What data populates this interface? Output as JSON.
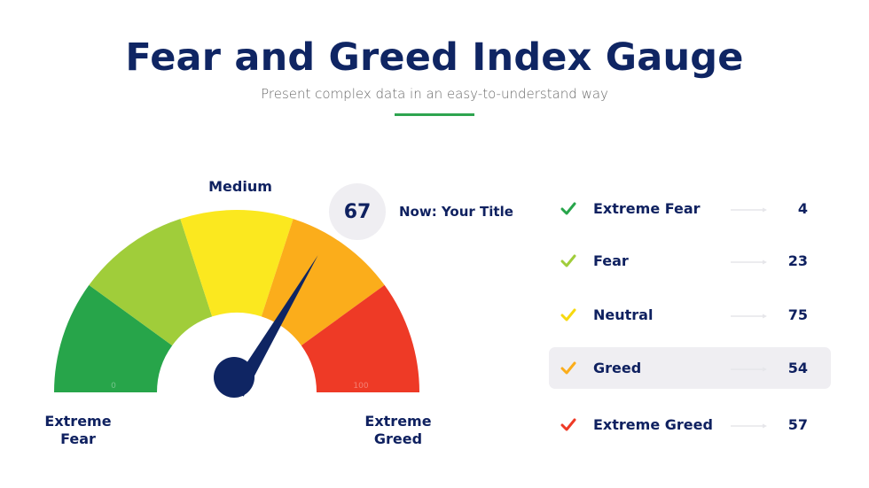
{
  "header": {
    "title": "Fear and Greed Index Gauge",
    "subtitle": "Present complex data in an easy-to-understand way",
    "accent_color": "#2ea44f"
  },
  "gauge": {
    "segments": [
      {
        "name": "Extreme Fear",
        "color": "#27a54a"
      },
      {
        "name": "Fear",
        "color": "#a0cd3a"
      },
      {
        "name": "Neutral",
        "color": "#fbe81f"
      },
      {
        "name": "Greed",
        "color": "#fbad1b"
      },
      {
        "name": "Extreme Greed",
        "color": "#ee3a26"
      }
    ],
    "min": 0,
    "max": 100,
    "min_label": "0",
    "max_label": "100",
    "value": 67,
    "needle_color": "#0f2563",
    "top_label": "Medium",
    "left_label_line1": "Extreme",
    "left_label_line2": "Fear",
    "right_label_line1": "Extreme",
    "right_label_line2": "Greed",
    "now_value": "67",
    "now_title": "Now: Your Title"
  },
  "legend": {
    "items": [
      {
        "label": "Extreme Fear",
        "value": "4",
        "check_color": "#27a54a",
        "icon": "check-icon",
        "arrow_icon": "arrow-right-icon",
        "highlighted": false
      },
      {
        "label": "Fear",
        "value": "23",
        "check_color": "#a0cd3a",
        "icon": "check-icon",
        "arrow_icon": "arrow-right-icon",
        "highlighted": false
      },
      {
        "label": "Neutral",
        "value": "75",
        "check_color": "#f7d90f",
        "icon": "check-icon",
        "arrow_icon": "arrow-right-icon",
        "highlighted": false
      },
      {
        "label": "Greed",
        "value": "54",
        "check_color": "#fbad1b",
        "icon": "check-icon",
        "arrow_icon": "arrow-right-icon",
        "highlighted": true
      },
      {
        "label": "Extreme Greed",
        "value": "57",
        "check_color": "#ee3a26",
        "icon": "check-icon",
        "arrow_icon": "arrow-right-icon",
        "highlighted": false
      }
    ]
  },
  "chart_data": {
    "type": "gauge",
    "title": "Fear and Greed Index Gauge",
    "subtitle": "Present complex data in an easy-to-understand way",
    "range": [
      0,
      100
    ],
    "categories": [
      "Extreme Fear",
      "Fear",
      "Neutral",
      "Greed",
      "Extreme Greed"
    ],
    "category_colors": [
      "#27a54a",
      "#a0cd3a",
      "#fbe81f",
      "#fbad1b",
      "#ee3a26"
    ],
    "needle_value": 67,
    "annotations": [
      "Medium",
      "Extreme Fear",
      "Extreme Greed",
      "67",
      "Now: Your Title"
    ],
    "tick_labels": [
      "0",
      "100"
    ],
    "legend_values": [
      {
        "label": "Extreme Fear",
        "value": 4
      },
      {
        "label": "Fear",
        "value": 23
      },
      {
        "label": "Neutral",
        "value": 75
      },
      {
        "label": "Greed",
        "value": 54
      },
      {
        "label": "Extreme Greed",
        "value": 57
      }
    ]
  }
}
